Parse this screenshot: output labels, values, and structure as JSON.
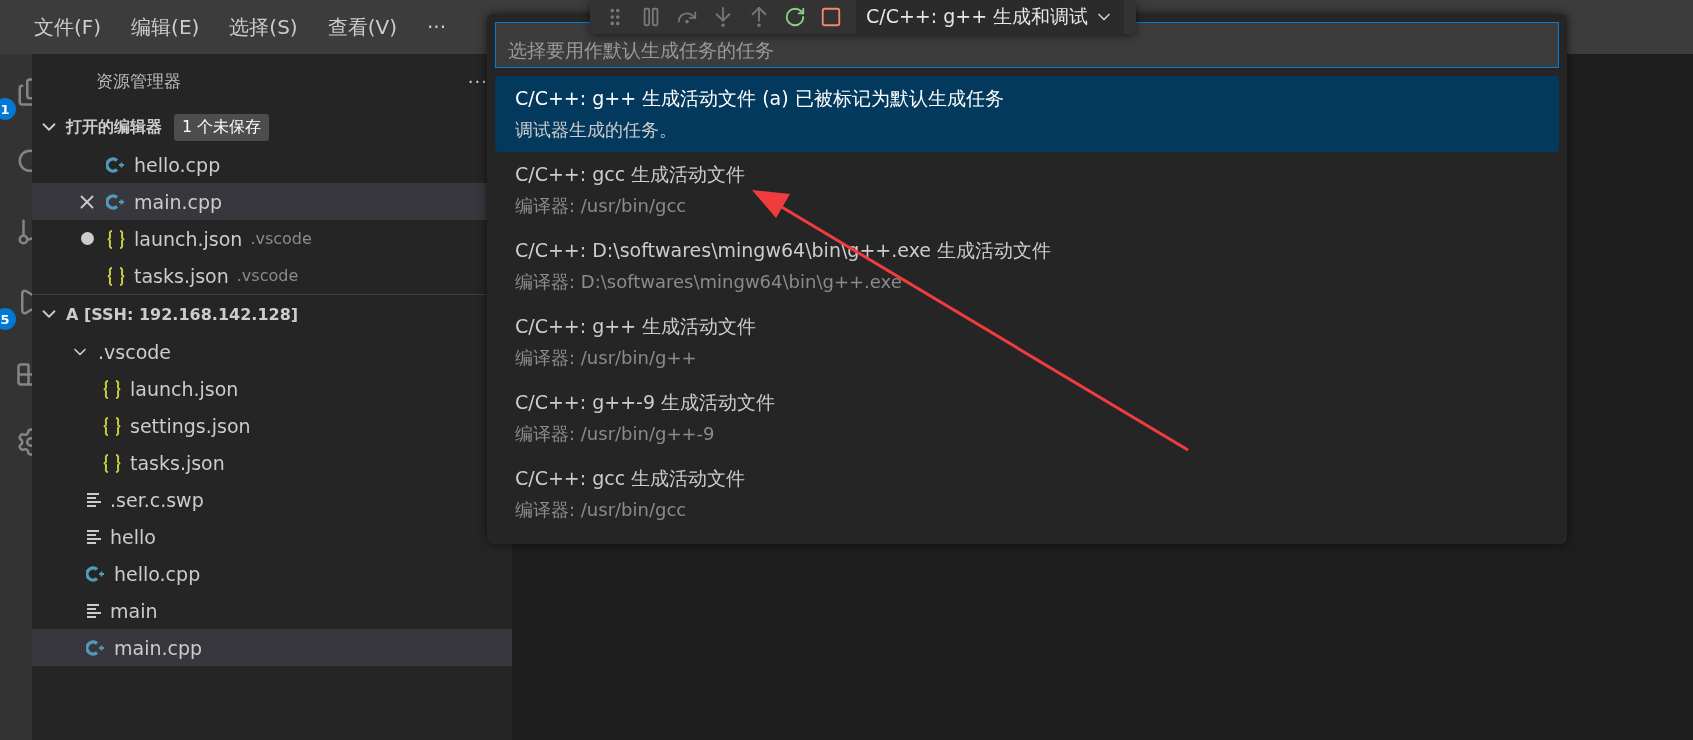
{
  "menu": [
    {
      "label": "文件(F)"
    },
    {
      "label": "编辑(E)"
    },
    {
      "label": "选择(S)"
    },
    {
      "label": "查看(V)"
    },
    {
      "label": "···"
    }
  ],
  "activity_bar": {
    "badges": [
      {
        "count": "1"
      },
      {
        "count": "5"
      }
    ]
  },
  "sidebar": {
    "title": "资源管理器",
    "more": "···",
    "open_editors": {
      "title": "打开的编辑器",
      "badge": "1 个未保存",
      "expanded": true,
      "items": [
        {
          "name": "hello.cpp",
          "kind": "cpp",
          "selected": false,
          "unsaved": false
        },
        {
          "name": "main.cpp",
          "kind": "cpp",
          "selected": true,
          "unsaved": false
        },
        {
          "name": "launch.json",
          "kind": "json",
          "description": ".vscode",
          "selected": false,
          "unsaved": true
        },
        {
          "name": "tasks.json",
          "kind": "json",
          "description": ".vscode",
          "selected": false,
          "unsaved": false
        }
      ]
    },
    "workspace": {
      "title": "A [SSH: 192.168.142.128]",
      "expanded": true,
      "children": [
        {
          "name": ".vscode",
          "kind": "folder",
          "expanded": true,
          "selected": false,
          "children": [
            {
              "name": "launch.json",
              "kind": "json",
              "selected": false
            },
            {
              "name": "settings.json",
              "kind": "json",
              "selected": false
            },
            {
              "name": "tasks.json",
              "kind": "json",
              "selected": false
            }
          ]
        },
        {
          "name": ".ser.c.swp",
          "kind": "text",
          "selected": false
        },
        {
          "name": "hello",
          "kind": "text",
          "selected": false
        },
        {
          "name": "hello.cpp",
          "kind": "cpp",
          "selected": false
        },
        {
          "name": "main",
          "kind": "text",
          "selected": false
        },
        {
          "name": "main.cpp",
          "kind": "cpp",
          "selected": true
        }
      ]
    }
  },
  "debug_toolbar": {
    "configuration": "C/C++: g++ 生成和调试"
  },
  "quick_pick": {
    "placeholder": "选择要用作默认生成任务的任务",
    "items": [
      {
        "label": "C/C++: g++ 生成活动文件 (a) 已被标记为默认生成任务",
        "detail": "调试器生成的任务。",
        "selected": true
      },
      {
        "label": "C/C++: gcc 生成活动文件",
        "detail": "编译器: /usr/bin/gcc",
        "selected": false
      },
      {
        "label": "C/C++: D:\\softwares\\mingw64\\bin\\g++.exe 生成活动文件",
        "detail": "编译器: D:\\softwares\\mingw64\\bin\\g++.exe",
        "selected": false
      },
      {
        "label": "C/C++: g++ 生成活动文件",
        "detail": "编译器: /usr/bin/g++",
        "selected": false
      },
      {
        "label": "C/C++: g++-9 生成活动文件",
        "detail": "编译器: /usr/bin/g++-9",
        "selected": false
      },
      {
        "label": "C/C++: gcc 生成活动文件",
        "detail": "编译器: /usr/bin/gcc",
        "selected": false
      }
    ]
  }
}
